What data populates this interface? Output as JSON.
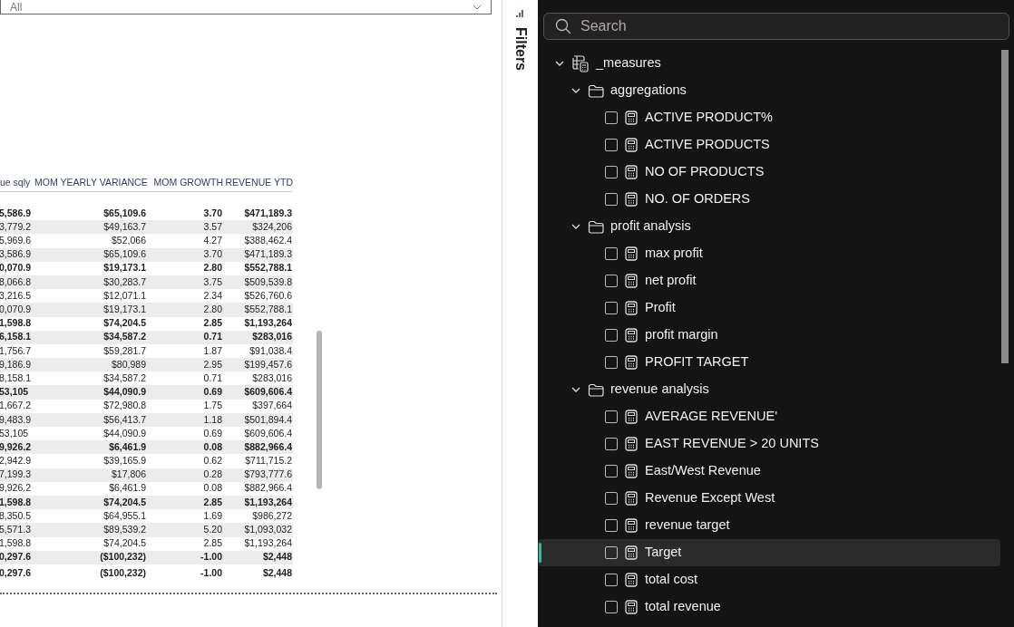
{
  "slicer": {
    "value": "All"
  },
  "table": {
    "columns": [
      "ue sqly",
      "MOM YEARLY VARIANCE",
      "MOM GROWTH",
      "REVENUE YTD"
    ],
    "rows": [
      {
        "kind": "subtotal",
        "cells": [
          "5,586.9",
          "$65,109.6",
          "3.70",
          "$471,189.3"
        ]
      },
      {
        "kind": "detail",
        "cells": [
          "3,779.2",
          "$49,163.7",
          "3.57",
          "$324,206"
        ]
      },
      {
        "kind": "detail",
        "cells": [
          "5,969.6",
          "$52,066",
          "4.27",
          "$388,462.4"
        ]
      },
      {
        "kind": "detail",
        "cells": [
          "3,586.9",
          "$65,109.6",
          "3.70",
          "$471,189.3"
        ]
      },
      {
        "kind": "subtotal",
        "cells": [
          "0,070.9",
          "$19,173.1",
          "2.80",
          "$552,788.1"
        ]
      },
      {
        "kind": "detail",
        "cells": [
          "8,066.8",
          "$30,283.7",
          "3.75",
          "$509,539.8"
        ]
      },
      {
        "kind": "detail",
        "cells": [
          "3,216.5",
          "$12,071.1",
          "2.34",
          "$526,760.6"
        ]
      },
      {
        "kind": "detail",
        "cells": [
          "0,070.9",
          "$19,173.1",
          "2.80",
          "$552,788.1"
        ]
      },
      {
        "kind": "subtotal",
        "cells": [
          "1,598.8",
          "$74,204.5",
          "2.85",
          "$1,193,264"
        ]
      },
      {
        "kind": "subtotal",
        "cells": [
          "6,158.1",
          "$34,587.2",
          "0.71",
          "$283,016"
        ]
      },
      {
        "kind": "detail",
        "cells": [
          "1,756.7",
          "$59,281.7",
          "1.87",
          "$91,038.4"
        ]
      },
      {
        "kind": "detail",
        "cells": [
          "9,186.9",
          "$80,989",
          "2.95",
          "$199,457.6"
        ]
      },
      {
        "kind": "detail",
        "cells": [
          "8,158.1",
          "$34,587.2",
          "0.71",
          "$283,016"
        ]
      },
      {
        "kind": "subtotal",
        "cells": [
          "53,105",
          "$44,090.9",
          "0.69",
          "$609,606.4"
        ]
      },
      {
        "kind": "detail",
        "cells": [
          "1,667.2",
          "$72,980.8",
          "1.75",
          "$397,664"
        ]
      },
      {
        "kind": "detail",
        "cells": [
          "9,483.9",
          "$56,413.7",
          "1.18",
          "$501,894.4"
        ]
      },
      {
        "kind": "detail",
        "cells": [
          "53,105",
          "$44,090.9",
          "0.69",
          "$609,606.4"
        ]
      },
      {
        "kind": "subtotal",
        "cells": [
          "9,926.2",
          "$6,461.9",
          "0.08",
          "$882,966.4"
        ]
      },
      {
        "kind": "detail",
        "cells": [
          "2,942.9",
          "$39,165.9",
          "0.62",
          "$711,715.2"
        ]
      },
      {
        "kind": "detail",
        "cells": [
          "7,199.3",
          "$17,806",
          "0.28",
          "$793,777.6"
        ]
      },
      {
        "kind": "detail",
        "cells": [
          "9,926.2",
          "$6,461.9",
          "0.08",
          "$882,966.4"
        ]
      },
      {
        "kind": "subtotal",
        "cells": [
          "1,598.8",
          "$74,204.5",
          "2.85",
          "$1,193,264"
        ]
      },
      {
        "kind": "detail",
        "cells": [
          "8,350.5",
          "$64,955.1",
          "1.69",
          "$986,272"
        ]
      },
      {
        "kind": "detail",
        "cells": [
          "5,571.3",
          "$89,539.2",
          "5.20",
          "$1,093,032"
        ]
      },
      {
        "kind": "detail",
        "cells": [
          "1,598.8",
          "$74,204.5",
          "2.85",
          "$1,193,264"
        ]
      },
      {
        "kind": "subtotal",
        "cells": [
          "0,297.6",
          "($100,232)",
          "-1.00",
          "$2,448"
        ]
      },
      {
        "kind": "total",
        "cells": [
          "0,297.6",
          "($100,232)",
          "-1.00",
          "$2,448"
        ]
      }
    ]
  },
  "filters_pane": {
    "label": "Filters"
  },
  "data_pane": {
    "search": {
      "placeholder": "Search"
    },
    "tree": [
      {
        "label": "_measures",
        "kind": "table",
        "expanded": true,
        "children": [
          {
            "label": "aggregations",
            "kind": "folder",
            "expanded": true,
            "children": [
              {
                "label": "ACTIVE PRODUCT%",
                "kind": "measure",
                "checked": false,
                "selected": false
              },
              {
                "label": "ACTIVE PRODUCTS",
                "kind": "measure",
                "checked": false,
                "selected": false
              },
              {
                "label": "NO OF PRODUCTS",
                "kind": "measure",
                "checked": false,
                "selected": false
              },
              {
                "label": "NO. OF ORDERS",
                "kind": "measure",
                "checked": false,
                "selected": false
              }
            ]
          },
          {
            "label": "profit analysis",
            "kind": "folder",
            "expanded": true,
            "children": [
              {
                "label": "max profit",
                "kind": "measure",
                "checked": false,
                "selected": false
              },
              {
                "label": "net profit",
                "kind": "measure",
                "checked": false,
                "selected": false
              },
              {
                "label": "Profit",
                "kind": "measure",
                "checked": false,
                "selected": false
              },
              {
                "label": "profit margin",
                "kind": "measure",
                "checked": false,
                "selected": false
              },
              {
                "label": "PROFIT TARGET",
                "kind": "measure",
                "checked": false,
                "selected": false
              }
            ]
          },
          {
            "label": "revenue analysis",
            "kind": "folder",
            "expanded": true,
            "children": [
              {
                "label": "AVERAGE REVENUE'",
                "kind": "measure",
                "checked": false,
                "selected": false
              },
              {
                "label": "EAST REVENUE > 20 UNITS",
                "kind": "measure",
                "checked": false,
                "selected": false
              },
              {
                "label": "East/West Revenue",
                "kind": "measure",
                "checked": false,
                "selected": false
              },
              {
                "label": "Revenue Except West",
                "kind": "measure",
                "checked": false,
                "selected": false
              },
              {
                "label": "revenue target",
                "kind": "measure",
                "checked": false,
                "selected": false
              },
              {
                "label": "Target",
                "kind": "measure",
                "checked": false,
                "selected": true
              },
              {
                "label": "total cost",
                "kind": "measure",
                "checked": false,
                "selected": false
              },
              {
                "label": "total revenue",
                "kind": "measure",
                "checked": false,
                "selected": false
              }
            ]
          }
        ]
      }
    ]
  }
}
